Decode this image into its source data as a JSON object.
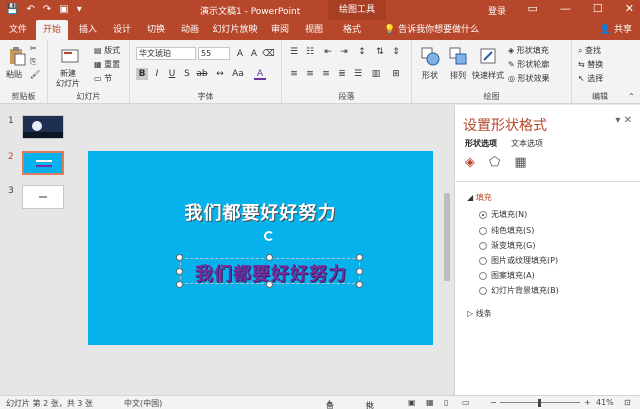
{
  "titlebar": {
    "title": "演示文稿1 - PowerPoint",
    "context_tool": "绘图工具",
    "login": "登录"
  },
  "tabs": [
    "文件",
    "开始",
    "插入",
    "设计",
    "切换",
    "动画",
    "幻灯片放映",
    "审阅",
    "视图",
    "格式"
  ],
  "active_tab": "开始",
  "tellme": "告诉我你想要做什么",
  "share": "共享",
  "ribbon": {
    "paste": "粘贴",
    "clipboard": "剪贴板",
    "new_slide": "新建",
    "new_slide2": "幻灯片",
    "layout": "版式",
    "reset": "重置",
    "section": "节",
    "slides": "幻灯片",
    "font_name": "华文琥珀",
    "font_size": "55",
    "font": "字体",
    "paragraph": "段落",
    "shapes": "形状",
    "arrange": "排列",
    "quick_styles": "快速样式",
    "shape_fill": "形状填充",
    "shape_outline": "形状轮廓",
    "shape_effects": "形状效果",
    "drawing": "绘图",
    "find": "查找",
    "replace": "替换",
    "select": "选择",
    "editing": "编辑"
  },
  "thumbnails": [
    "1",
    "2",
    "3"
  ],
  "slide": {
    "title_text": "我们都要好好努力",
    "wordart_text": "我们都要好好努力"
  },
  "pane": {
    "title": "设置形状格式",
    "tab_shape": "形状选项",
    "tab_text": "文本选项",
    "fill_section": "填充",
    "options": [
      "无填充(N)",
      "纯色填充(S)",
      "渐变填充(G)",
      "图片或纹理填充(P)",
      "图案填充(A)",
      "幻灯片背景填充(B)"
    ],
    "selected_option": 0,
    "line_section": "线条"
  },
  "status": {
    "slide_info": "幻灯片 第 2 张，共 3 张",
    "language": "中文(中国)",
    "notes": "备注",
    "comments": "批注",
    "zoom": "41%"
  },
  "colors": {
    "accent": "#b7472a",
    "slide_bg": "#06b2ec",
    "wordart": "#7030a0"
  }
}
